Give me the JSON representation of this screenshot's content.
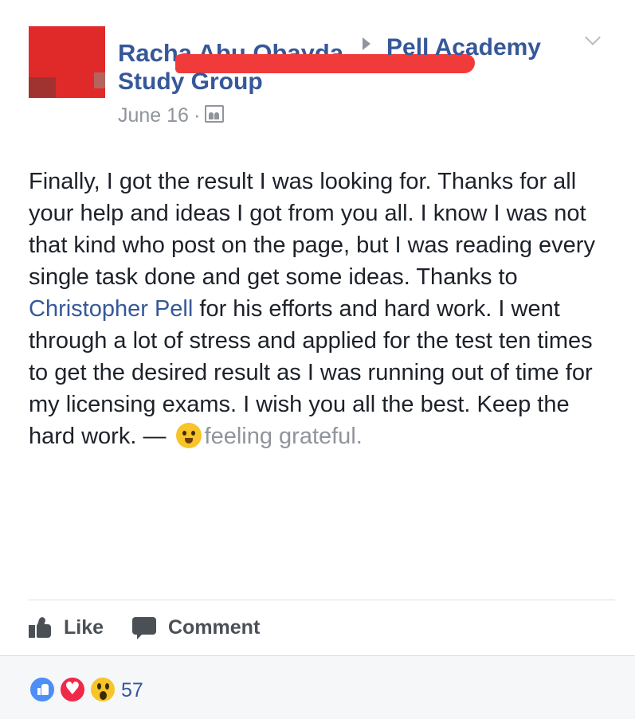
{
  "header": {
    "author_name": "Racha Abu Obayda",
    "group_name": "Pell Academy Study Group",
    "date": "June 16",
    "separator": "·",
    "audience_icon": "group-audience-icon",
    "menu_icon": "chevron-down-icon"
  },
  "post": {
    "text_before_mention": "Finally, I got the result I was looking for. Thanks for all your help and ideas I got from you all. I know I was not that kind who post on the page, but I was reading every single task done and get some ideas. Thanks to ",
    "mention": "Christopher Pell",
    "text_after_mention": " for his efforts and hard work. I went through a lot of stress and applied for the test ten times to get the desired result as I was running out of time for my licensing exams. I wish you all the best. Keep the hard work. —",
    "feeling_emoji": "grateful-face-emoji",
    "feeling": "feeling grateful."
  },
  "actions": {
    "like_label": "Like",
    "comment_label": "Comment"
  },
  "reactions": {
    "types": [
      "like",
      "love",
      "wow"
    ],
    "count": "57"
  },
  "colors": {
    "link": "#365899",
    "text": "#1d2129",
    "muted": "#90949c",
    "redaction": "#f13b3b",
    "like_reaction": "#4d8ef7",
    "love_reaction": "#f0284a",
    "wow_reaction": "#f7c42a"
  }
}
